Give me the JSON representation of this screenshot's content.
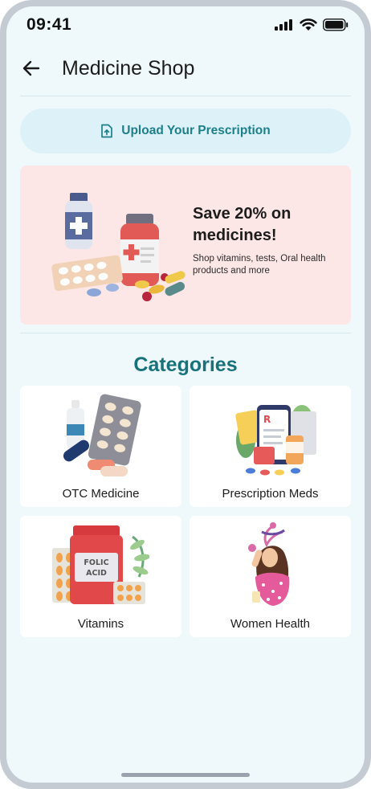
{
  "status_bar": {
    "time": "09:41"
  },
  "header": {
    "title": "Medicine Shop"
  },
  "upload": {
    "label": "Upload Your Prescription"
  },
  "promo": {
    "headline": "Save 20% on medicines!",
    "subtext": "Shop vitamins, tests, Oral health products and more"
  },
  "categories": {
    "title": "Categories",
    "items": [
      {
        "label": "OTC Medicine"
      },
      {
        "label": "Prescription Meds"
      },
      {
        "label": "Vitamins",
        "art_text": [
          "FOLIC",
          "ACID"
        ]
      },
      {
        "label": "Women Health"
      }
    ]
  },
  "colors": {
    "accent": "#17727b",
    "background": "#eff9fc",
    "banner": "#fde6e6",
    "upload_bg": "#ddf1f8"
  }
}
